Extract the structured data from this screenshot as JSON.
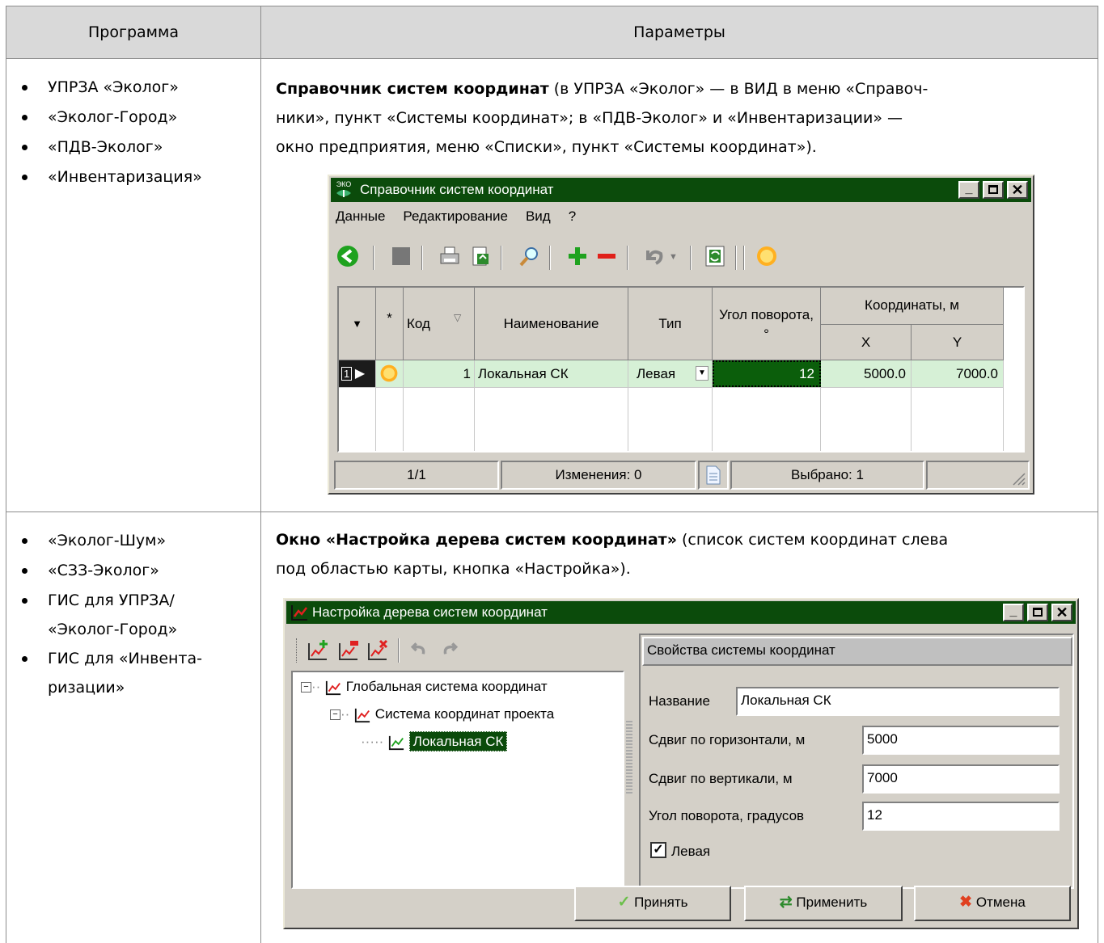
{
  "header": {
    "col1": "Программа",
    "col2": "Параметры"
  },
  "row1": {
    "programs": [
      "УПРЗА «Эколог»",
      "«Эколог-Город»",
      "«ПДВ-Эколог»",
      "«Инвентаризация»"
    ],
    "desc_bold": "Справочник систем координат",
    "desc_line1": " (в УПРЗА «Эколог» — в ВИД в меню «Справоч-",
    "desc_line2": "ники», пункт «Системы координат»; в «ПДВ-Эколог» и «Инвентаризации» —",
    "desc_line3": "окно предприятия, меню «Списки», пункт «Системы координат»)."
  },
  "win1": {
    "icon_text": "ЭКО",
    "title": "Справочник систем координат",
    "menu": [
      "Данные",
      "Редактирование",
      "Вид",
      "?"
    ],
    "toolbar_icons": [
      "back-icon",
      "save-icon",
      "print-icon",
      "export-icon",
      "find-icon",
      "add-icon",
      "remove-icon",
      "undo-icon",
      "undo-dropdown-icon",
      "refresh-icon",
      "sun-icon"
    ],
    "columns": {
      "star": "*",
      "code": "Код",
      "name": "Наименование",
      "type": "Тип",
      "angle": "Угол поворота, °",
      "coords": "Координаты, м",
      "x": "X",
      "y": "Y"
    },
    "rows": [
      {
        "num": "1",
        "code": "1",
        "name": "Локальная СК",
        "type": "Левая",
        "angle": "12",
        "x": "5000.0",
        "y": "7000.0"
      }
    ],
    "status": {
      "pos": "1/1",
      "changes": "Изменения: 0",
      "selected": "Выбрано: 1"
    }
  },
  "row2": {
    "programs": [
      "«Эколог-Шум»",
      "«СЗЗ-Эколог»",
      "ГИС для УПРЗА/",
      "«Эколог-Город»",
      "ГИС для «Инвента-",
      "ризации»"
    ],
    "desc_bold": "Окно «Настройка дерева систем координат»",
    "desc_line1": " (список систем координат слева",
    "desc_line2": "под областью карты, кнопка «Настройка»)."
  },
  "win2": {
    "title": "Настройка дерева систем координат",
    "tree": [
      "Глобальная система координат",
      "Система координат проекта",
      "Локальная СК"
    ],
    "props_title": "Свойства системы координат",
    "fields": {
      "name_label": "Название",
      "name_value": "Локальная СК",
      "hshift_label": "Сдвиг по горизонтали, м",
      "hshift_value": "5000",
      "vshift_label": "Сдвиг по вертикали, м",
      "vshift_value": "7000",
      "angle_label": "Угол поворота, градусов",
      "angle_value": "12",
      "left_label": "Левая",
      "left_checked": true
    },
    "buttons": {
      "accept": "Принять",
      "apply": "Применить",
      "cancel": "Отмена"
    }
  }
}
